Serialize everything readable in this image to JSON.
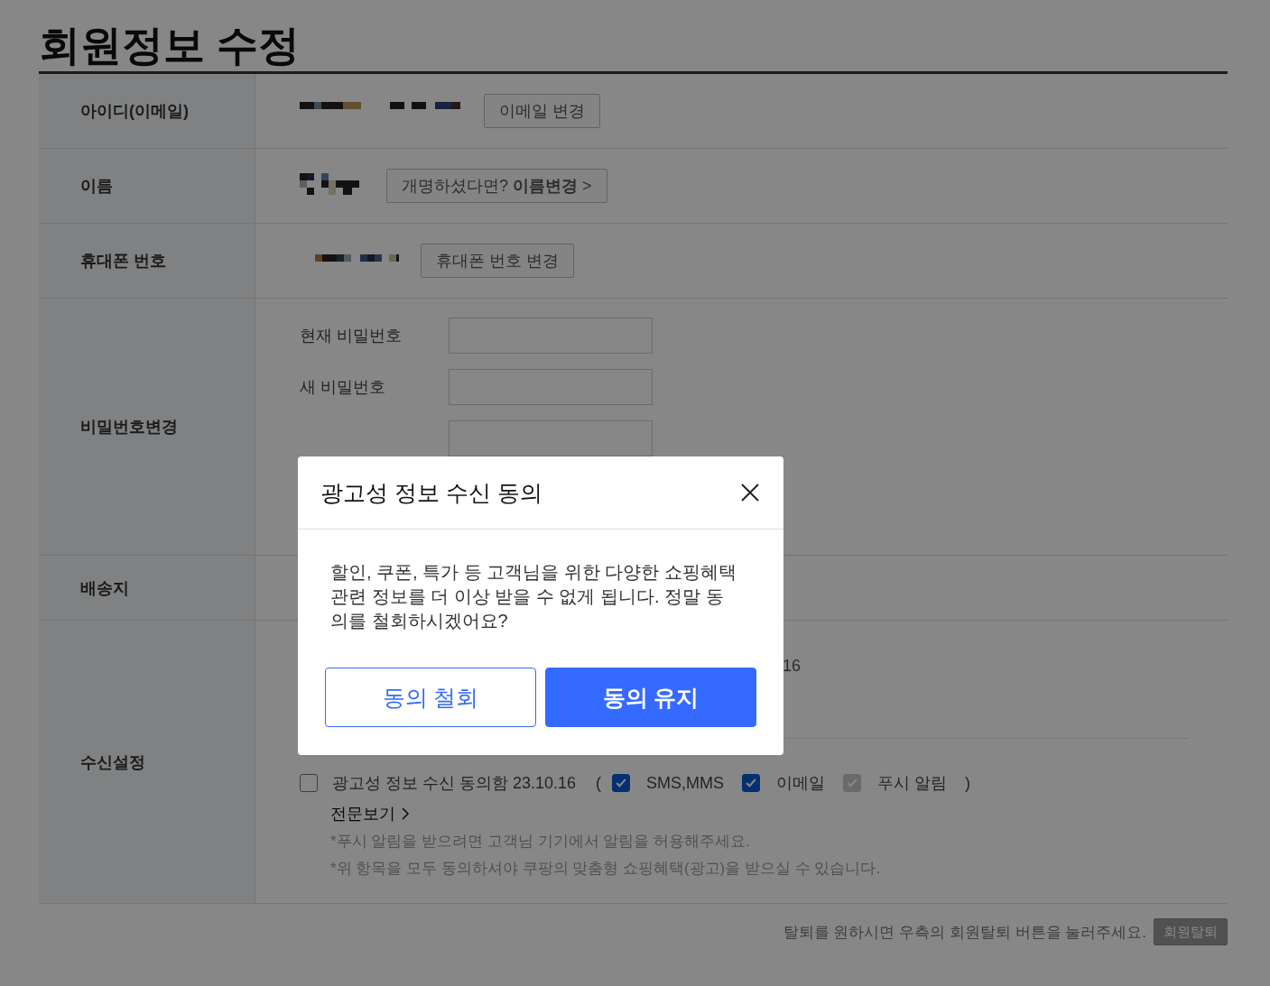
{
  "page_title": "회원정보 수정",
  "rows": [
    {
      "kind": "value_button",
      "label": "아이디(이메일)",
      "button": "이메일 변경"
    },
    {
      "kind": "value_button",
      "label": "이름",
      "button": "개명하셨다면? **이름변경** >"
    },
    {
      "kind": "value_button",
      "label": "휴대폰 번호",
      "button": "휴대폰 번호 변경"
    },
    {
      "kind": "password",
      "label": "비밀번호변경",
      "fields": [
        {
          "label": "현재 비밀번호"
        },
        {
          "label": "새 비밀번호"
        }
      ],
      "unlabeled_field": true
    },
    {
      "kind": "plain",
      "label": "배송지"
    },
    {
      "kind": "consent",
      "label": "수신설정",
      "partial_text": "16",
      "consent": {
        "checked": false,
        "label": "광고성 정보 수신 동의함 23.10.16",
        "open_paren": "(",
        "close_paren": ")",
        "channels": [
          {
            "label": "SMS,MMS",
            "checked": true,
            "disabled": false
          },
          {
            "label": "이메일",
            "checked": true,
            "disabled": false
          },
          {
            "label": "푸시 알림",
            "checked": true,
            "disabled": true
          }
        ],
        "link": "전문보기",
        "notes": [
          "*푸시 알림을 받으려면 고객님 기기에서 알림을 허용해주세요.",
          "*위 항목을 모두 동의하셔야 쿠팡의 맞춤형 쇼핑혜택(광고)을 받으실 수 있습니다."
        ]
      }
    }
  ],
  "footer": {
    "text": "탈퇴를 원하시면 우측의 회원탈퇴 버튼을 눌러주세요.",
    "button": "회원탈퇴"
  },
  "dialog": {
    "title": "광고성 정보 수신 동의",
    "body": "할인, 쿠폰, 특가 등 고객님을 위한 다양한 쇼핑혜택 관련 정보를 더 이상 받을 수 없게 됩니다. 정말 동의를 철회하시겠어요?",
    "buttons": [
      {
        "label": "동의 철회",
        "kind": "outline"
      },
      {
        "label": "동의 유지",
        "kind": "primary"
      }
    ]
  }
}
